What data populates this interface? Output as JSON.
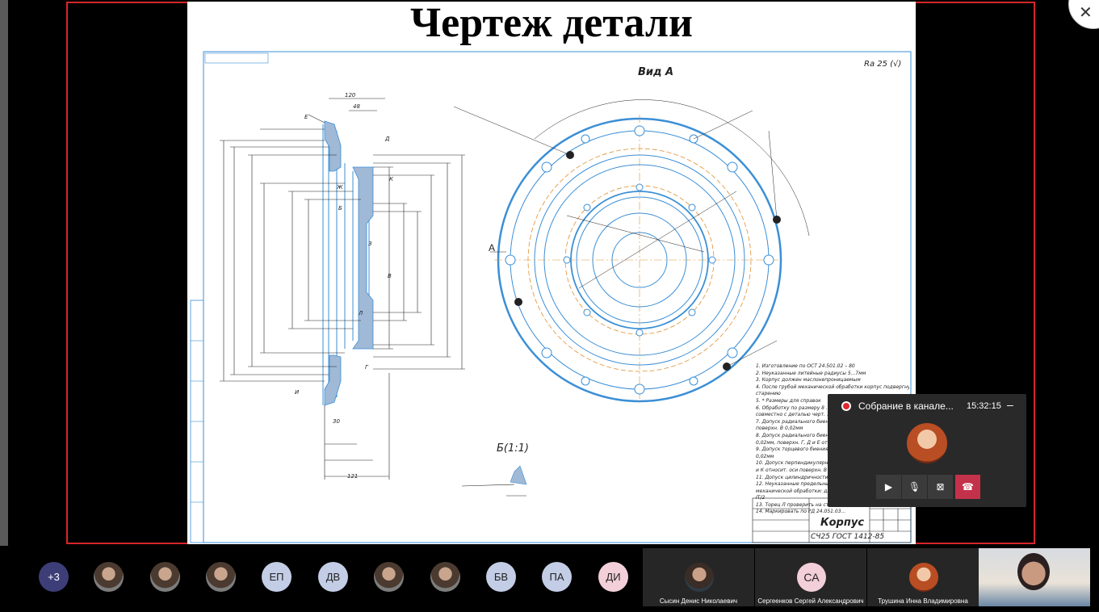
{
  "slide": {
    "title": "Чертеж детали",
    "view_label": "Вид А",
    "section_label": "Б(1:1)",
    "arrow_label": "А",
    "roughness": "Ra 25 (√)",
    "notes": [
      "1. Изготовление по ОСТ 24.501.02 – 80",
      "2. Неуказанные литейные радиусы 5...7мм",
      "3. Корпус должен маслонепроницаемым",
      "4. После грубой механической обработки корпус подвергнуть",
      "старению",
      "5. * Размеры для справок",
      "6. Обработку по размеру 8 ... производить",
      "совместно с деталью черт. 1",
      "7. Допуск радиального биения ...",
      "поверхн. В 0,02мм",
      "8. Допуск радиального биения пов...",
      "0,02мм, поверхн. Г, Д и Е относ...",
      "9. Допуск торцевого биения ...",
      "0,02мм",
      "10. Допуск перпендикулярности ...",
      "и К относит. оси поверхн. В 0,02...",
      "11. Допуск цилиндричности поверх...",
      "12. Неуказанные предельные ...",
      "механической обработки: для ...",
      "IT/2",
      "13. Торец Л проверить на стенде ...",
      "14. Маркировать по РД 24.051.03..."
    ],
    "stamp_title": "Корпус",
    "stamp_material": "СЧ25 ГОСТ 1412-85"
  },
  "meeting": {
    "title": "Собрание в канале...",
    "time": "15:32:15",
    "minimize": "–",
    "controls": [
      {
        "name": "camera-button",
        "icon": "camera-icon",
        "glyph": "▶"
      },
      {
        "name": "mic-button",
        "icon": "microphone-icon",
        "glyph": "🎙"
      },
      {
        "name": "share-button",
        "icon": "share-screen-icon",
        "glyph": "⊠"
      },
      {
        "name": "hangup-button",
        "icon": "hangup-icon",
        "glyph": "☎"
      }
    ]
  },
  "roster": {
    "more": "+3",
    "initials": [
      "ЕП",
      "ДВ",
      "БВ",
      "ПА",
      "ДИ"
    ],
    "tiles": [
      {
        "name": "Сысин Денис Николаевич",
        "initials": ""
      },
      {
        "name": "Сергеенков Сергей Александрович",
        "initials": "СА"
      },
      {
        "name": "Трушина Инна Владимировна",
        "initials": ""
      }
    ]
  },
  "colors": {
    "accent_red": "#d6262c",
    "drawing_blue": "#3b8fd6",
    "drawing_orange": "#e09030",
    "initial_chip": "#c3cde5",
    "more_chip": "#3d3d78",
    "hangup": "#c4314b"
  }
}
